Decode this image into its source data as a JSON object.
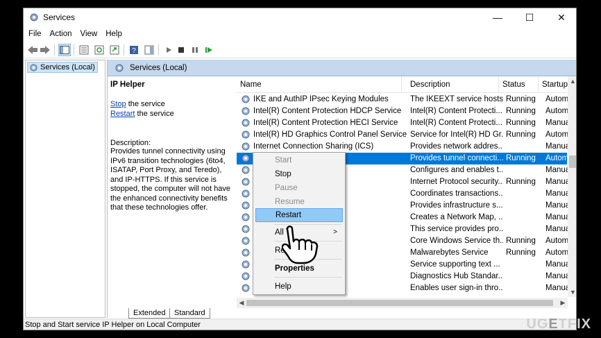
{
  "window": {
    "title": "Services",
    "minimize_glyph": "—",
    "maximize_glyph": "☐",
    "close_glyph": "✕"
  },
  "menu": [
    "File",
    "Action",
    "View",
    "Help"
  ],
  "toolbar": {
    "icons": [
      "back-icon",
      "forward-icon",
      "show-hide-tree-icon",
      "properties-icon",
      "refresh-icon",
      "export-list-icon",
      "help-icon",
      "show-action-pane-icon",
      "start-icon",
      "stop-icon",
      "pause-icon",
      "restart-icon"
    ]
  },
  "tree": {
    "root_label": "Services (Local)"
  },
  "pane": {
    "title": "Services (Local)"
  },
  "details": {
    "service_name": "IP Helper",
    "stop_link": "Stop",
    "stop_suffix": " the service",
    "restart_link": "Restart",
    "restart_suffix": " the service",
    "description_label": "Description:",
    "description": "Provides tunnel connectivity using IPv6 transition technologies (6to4, ISATAP, Port Proxy, and Teredo), and IP-HTTPS. If this service is stopped, the computer will not have the enhanced connectivity benefits that these technologies offer."
  },
  "columns": {
    "name": "Name",
    "description": "Description",
    "status": "Status",
    "startup": "Startup"
  },
  "rows": [
    {
      "name": "IKE and AuthIP IPsec Keying Modules",
      "desc": "The IKEEXT service hosts ...",
      "status": "Running",
      "startup": "Autom"
    },
    {
      "name": "Intel(R) Content Protection HDCP Service",
      "desc": "Intel(R) Content Protecti...",
      "status": "Running",
      "startup": "Autom"
    },
    {
      "name": "Intel(R) Content Protection HECI Service",
      "desc": "Intel(R) Content Protecti...",
      "status": "Running",
      "startup": "Manua"
    },
    {
      "name": "Intel(R) HD Graphics Control Panel Service",
      "desc": "Service for Intel(R) HD Gr...",
      "status": "Running",
      "startup": "Autom"
    },
    {
      "name": "Internet Connection Sharing (ICS)",
      "desc": "Provides network addres...",
      "status": "",
      "startup": "Manua"
    },
    {
      "name": "",
      "desc": "Provides tunnel connecti...",
      "status": "Running",
      "startup": "Autom",
      "selected": true
    },
    {
      "name": "ervice",
      "desc": "Configures and enables t...",
      "status": "",
      "startup": "Manua"
    },
    {
      "name": "",
      "desc": "Internet Protocol security...",
      "status": "Running",
      "startup": "Manua"
    },
    {
      "name": "action Coordin...",
      "desc": "Coordinates transactions...",
      "status": "",
      "startup": "Manua"
    },
    {
      "name": "",
      "desc": "Provides infrastructure s...",
      "status": "",
      "startup": "Manua"
    },
    {
      "name": "ery Mapper",
      "desc": "Creates a Network Map, ...",
      "status": "",
      "startup": "Manua"
    },
    {
      "name": "e",
      "desc": "This service provides pro...",
      "status": "",
      "startup": "Manua"
    },
    {
      "name": "",
      "desc": "Core Windows Service th...",
      "status": "Running",
      "startup": "Autom"
    },
    {
      "name": "",
      "desc": "Malwarebytes Service",
      "status": "Running",
      "startup": "Autom"
    },
    {
      "name": "",
      "desc": "Service supporting text ...",
      "status": "",
      "startup": "Manua"
    },
    {
      "name": "ub Standard Co...",
      "desc": "Diagnostics Hub Standar...",
      "status": "",
      "startup": "Manua"
    },
    {
      "name": "ssistant",
      "desc": "Enables user sign-in thro...",
      "status": "",
      "startup": "Manua"
    }
  ],
  "context_menu": {
    "start": "Start",
    "stop": "Stop",
    "pause": "Pause",
    "resume": "Resume",
    "restart": "Restart",
    "all_tasks": "All T",
    "all_tasks_arrow": ">",
    "refresh": "Refr",
    "properties": "Properties",
    "help": "Help"
  },
  "tabs": {
    "extended": "Extended",
    "standard": "Standard"
  },
  "status_bar": "Stop and Start service IP Helper on Local Computer",
  "watermark": {
    "left": "UG",
    "middle": "E",
    "right": "TFIX"
  },
  "colors": {
    "selection": "#0078d7",
    "pane_header": "#c5d8ec",
    "menu_highlight": "#91c9f7"
  }
}
